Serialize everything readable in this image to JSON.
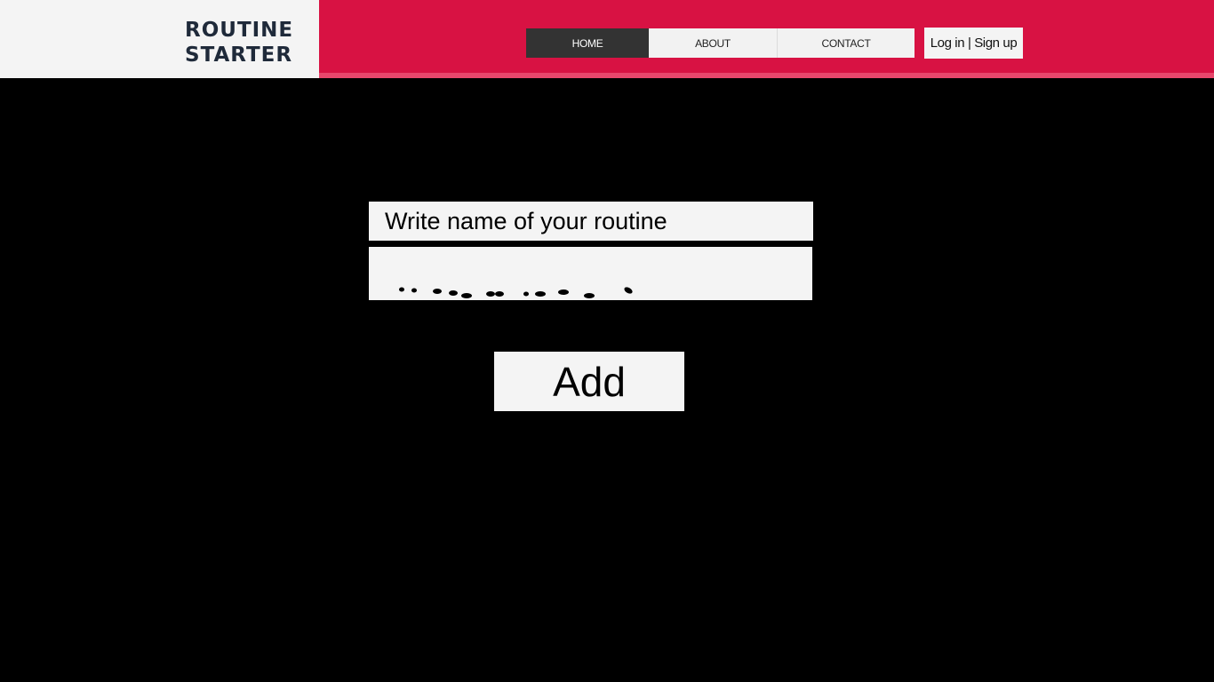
{
  "brand": {
    "line1": "ROUTINE",
    "line2": "STARTER",
    "colors": {
      "header": "#d81243",
      "stripe": "#e8476c",
      "logo_bg": "#f4f4f4",
      "logo_text": "#1f2a3a"
    }
  },
  "nav": {
    "tabs": [
      {
        "label": "HOME",
        "active": true
      },
      {
        "label": "ABOUT",
        "active": false
      },
      {
        "label": "CONTACT",
        "active": false
      }
    ],
    "auth_label": "Log in | Sign up"
  },
  "form": {
    "name_label": "Write name of your routine",
    "routine_input_value": "",
    "add_label": "Add"
  }
}
